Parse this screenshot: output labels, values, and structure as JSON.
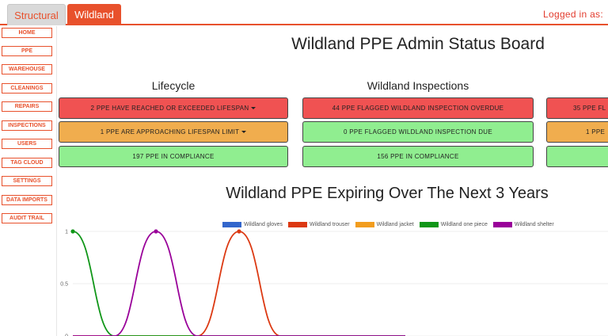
{
  "topbar": {
    "tabs": [
      {
        "label": "Structural",
        "active": false
      },
      {
        "label": "Wildland",
        "active": true
      }
    ],
    "logged_in_label": "Logged in as:"
  },
  "sidebar": {
    "items": [
      {
        "label": "HOME"
      },
      {
        "label": "PPE"
      },
      {
        "label": "WAREHOUSE"
      },
      {
        "label": "CLEANINGS"
      },
      {
        "label": "REPAIRS"
      },
      {
        "label": "INSPECTIONS"
      },
      {
        "label": "USERS"
      },
      {
        "label": "TAG CLOUD"
      },
      {
        "label": "SETTINGS"
      },
      {
        "label": "DATA IMPORTS"
      },
      {
        "label": "AUDIT TRAIL"
      }
    ]
  },
  "main": {
    "title": "Wildland PPE Admin Status Board",
    "columns": [
      {
        "heading": "Lifecycle",
        "cards": [
          {
            "text": "2 PPE HAVE REACHED OR EXCEEDED LIFESPAN",
            "status": "red",
            "dropdown": true
          },
          {
            "text": "1 PPE ARE APPROACHING LIFESPAN LIMIT",
            "status": "orange",
            "dropdown": true
          },
          {
            "text": "197 PPE IN COMPLIANCE",
            "status": "green",
            "dropdown": false
          }
        ]
      },
      {
        "heading": "Wildland Inspections",
        "cards": [
          {
            "text": "44 PPE FLAGGED WILDLAND INSPECTION OVERDUE",
            "status": "red",
            "dropdown": false
          },
          {
            "text": "0 PPE FLAGGED WILDLAND INSPECTION DUE",
            "status": "green",
            "dropdown": false
          },
          {
            "text": "156 PPE IN COMPLIANCE",
            "status": "green",
            "dropdown": false
          }
        ]
      },
      {
        "heading": "",
        "cards": [
          {
            "text": "35 PPE FL",
            "status": "red",
            "dropdown": false
          },
          {
            "text": "1 PPE",
            "status": "orange",
            "dropdown": false
          },
          {
            "text": "",
            "status": "green",
            "dropdown": false
          }
        ]
      }
    ],
    "status_colors": {
      "red": "#f05252",
      "orange": "#f0ad4e",
      "green": "#90ee90"
    }
  },
  "chart_data": {
    "type": "line",
    "title": "Wildland PPE Expiring Over The Next 3 Years",
    "ylim": [
      0,
      1
    ],
    "y_ticks": [
      "1",
      "0.5",
      "0"
    ],
    "grid": true,
    "legend_position": "top",
    "x": [
      0,
      1,
      2,
      3,
      4,
      5,
      6,
      7,
      8
    ],
    "series": [
      {
        "name": "Wildland gloves",
        "color": "#3366cc",
        "values": [
          0,
          0,
          0,
          0,
          0,
          0,
          0,
          0,
          0
        ]
      },
      {
        "name": "Wildland trouser",
        "color": "#dc3912",
        "values": [
          0,
          0,
          0,
          0,
          1,
          0,
          0,
          0,
          0
        ]
      },
      {
        "name": "Wildland jacket",
        "color": "#f29d1e",
        "values": [
          0,
          0,
          0,
          0,
          0,
          0,
          0,
          0,
          0
        ]
      },
      {
        "name": "Wildland one piece",
        "color": "#109618",
        "values": [
          1,
          0,
          0,
          0,
          0,
          0,
          0,
          0,
          0
        ]
      },
      {
        "name": "Wildland shelter",
        "color": "#990099",
        "values": [
          0,
          0,
          1,
          0,
          0,
          0,
          0,
          0,
          0
        ]
      }
    ]
  }
}
